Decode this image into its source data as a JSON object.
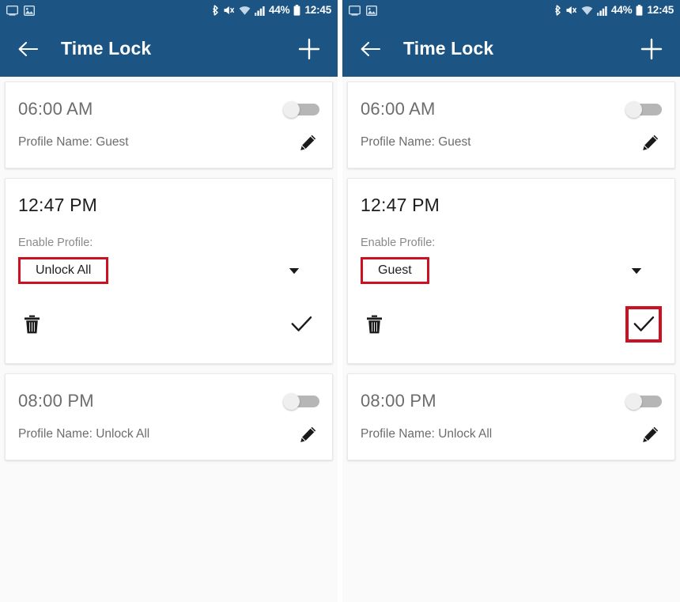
{
  "colors": {
    "appbar": "#1c5484",
    "highlight": "#cc1122",
    "card": "#ffffff",
    "background": "#fafafa",
    "muted_text": "#6d6d6d",
    "primary_text": "#1d1d1d"
  },
  "status_bar": {
    "icons": [
      "screen-cast-icon",
      "screenshot-image-icon",
      "bluetooth-icon",
      "vibrate-mute-icon",
      "wifi-icon",
      "cellular-signal-icon"
    ],
    "battery_percent": "44%",
    "clock": "12:45"
  },
  "app_bar": {
    "back_label": "back-arrow",
    "title": "Time Lock",
    "add_label": "add"
  },
  "panels": [
    {
      "id": "left",
      "alarms": [
        {
          "time": "06:00 AM",
          "profile_text": "Profile Name: Guest",
          "enabled": false,
          "expanded": false
        },
        {
          "time": "12:47 PM",
          "enable_label": "Enable Profile:",
          "selected_profile": "Unlock All",
          "expanded": true,
          "select_highlighted": true,
          "confirm_highlighted": false
        },
        {
          "time": "08:00 PM",
          "profile_text": "Profile Name: Unlock All",
          "enabled": false,
          "expanded": false
        }
      ]
    },
    {
      "id": "right",
      "alarms": [
        {
          "time": "06:00 AM",
          "profile_text": "Profile Name: Guest",
          "enabled": false,
          "expanded": false
        },
        {
          "time": "12:47 PM",
          "enable_label": "Enable Profile:",
          "selected_profile": "Guest",
          "expanded": true,
          "select_highlighted": true,
          "confirm_highlighted": true
        },
        {
          "time": "08:00 PM",
          "profile_text": "Profile Name: Unlock All",
          "enabled": false,
          "expanded": false
        }
      ]
    }
  ]
}
